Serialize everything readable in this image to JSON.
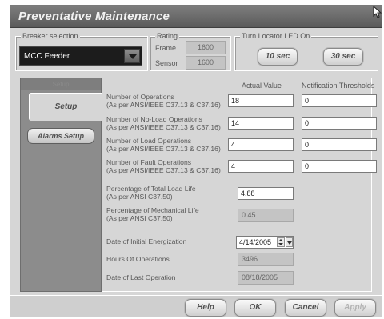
{
  "window": {
    "title": "Preventative Maintenance"
  },
  "breaker": {
    "label": "Breaker selection",
    "value": "MCC Feeder"
  },
  "rating": {
    "label": "Rating",
    "frame_label": "Frame",
    "frame_value": "1600",
    "sensor_label": "Sensor",
    "sensor_value": "1600"
  },
  "locator": {
    "label": "Turn Locator LED On",
    "btn_10": "10 sec",
    "btn_30": "30 sec"
  },
  "sidebar": {
    "top_tab": "Setup",
    "setup_tab": "Setup",
    "alarms_button": "Alarms Setup"
  },
  "table": {
    "col_actual": "Actual Value",
    "col_threshold": "Notification Thresholds",
    "rows": [
      {
        "line1": "Number of Operations",
        "line2": "(As per ANSI/IEEE C37.13 & C37.16)",
        "actual": "18",
        "threshold": "0"
      },
      {
        "line1": "Number of No-Load Operations",
        "line2": "(As per ANSI/IEEE C37.13 & C37.16)",
        "actual": "14",
        "threshold": "0"
      },
      {
        "line1": "Number of Load Operations",
        "line2": "(As per ANSI/IEEE C37.13 & C37.16)",
        "actual": "4",
        "threshold": "0"
      },
      {
        "line1": "Number of Fault Operations",
        "line2": "(As per ANSI/IEEE C37.13 & C37.16)",
        "actual": "4",
        "threshold": "0"
      }
    ]
  },
  "life": {
    "total_load_line1": "Percentage of Total Load Life",
    "total_load_line2": "(As per ANSI C37.50)",
    "total_load_value": "4.88",
    "mechanical_line1": "Percentage of Mechanical Life",
    "mechanical_line2": "(As per ANSI C37.50)",
    "mechanical_value": "0.45"
  },
  "dates": {
    "initial_label": "Date of Initial Energization",
    "initial_value": "4/14/2005",
    "hours_label": "Hours Of Operations",
    "hours_value": "3496",
    "last_op_label": "Date of Last Operation",
    "last_op_value": "08/18/2005"
  },
  "footer": {
    "help": "Help",
    "ok": "OK",
    "cancel": "Cancel",
    "apply": "Apply"
  },
  "icons": {
    "cursor": "mouse-pointer-icon",
    "dropdown": "chevron-down-icon"
  }
}
